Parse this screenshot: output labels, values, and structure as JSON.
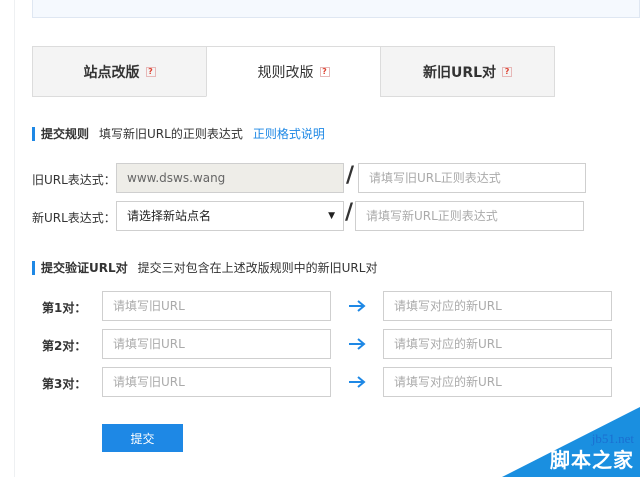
{
  "tabs": [
    {
      "label": "站点改版",
      "help": "?"
    },
    {
      "label": "规则改版",
      "help": "?"
    },
    {
      "label": "新旧URL对",
      "help": "?"
    }
  ],
  "rules_section": {
    "title": "提交规则",
    "description": "填写新旧URL的正则表达式",
    "link": "正则格式说明"
  },
  "old_url_row": {
    "label": "旧URL表达式：",
    "value": "www.dsws.wang",
    "separator": "/",
    "regex_placeholder": "请填写旧URL正则表达式"
  },
  "new_url_row": {
    "label": "新URL表达式：",
    "select_value": "请选择新站点名",
    "separator": "/",
    "regex_placeholder": "请填写新URL正则表达式"
  },
  "verify_section": {
    "title": "提交验证URL对",
    "description": "提交三对包含在上述改版规则中的新旧URL对"
  },
  "pairs": [
    {
      "label": "第1对：",
      "old_placeholder": "请填写旧URL",
      "new_placeholder": "请填写对应的新URL"
    },
    {
      "label": "第2对：",
      "old_placeholder": "请填写旧URL",
      "new_placeholder": "请填写对应的新URL"
    },
    {
      "label": "第3对：",
      "old_placeholder": "请填写旧URL",
      "new_placeholder": "请填写对应的新URL"
    }
  ],
  "submit_label": "提交",
  "watermark": {
    "site": "jb51.net",
    "name": "脚本之家"
  },
  "colors": {
    "accent": "#1e88e5",
    "filled_bg": "#eeede8",
    "help_red": "#dd4433"
  }
}
